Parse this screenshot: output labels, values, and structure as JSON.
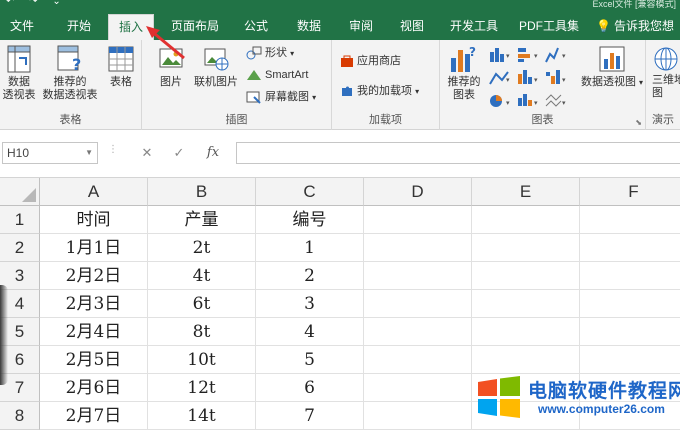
{
  "window": {
    "title": "Excel文件 [兼容模式]"
  },
  "quick_access": {
    "icon_text": "↶ ↷ ⌄"
  },
  "tabs": [
    {
      "label": "文件"
    },
    {
      "label": "开始"
    },
    {
      "label": "插入"
    },
    {
      "label": "页面布局"
    },
    {
      "label": "公式"
    },
    {
      "label": "数据"
    },
    {
      "label": "审阅"
    },
    {
      "label": "视图"
    },
    {
      "label": "开发工具"
    },
    {
      "label": "PDF工具集"
    },
    {
      "label": "告诉我您想"
    }
  ],
  "ribbon": {
    "tables": {
      "label": "表格",
      "pivot_table": "数据\n透视表",
      "recommended_pivot": "推荐的\n数据透视表",
      "table": "表格"
    },
    "illustrations": {
      "label": "插图",
      "pictures": "图片",
      "online_pictures": "联机图片",
      "shapes": "形状",
      "smartart": "SmartArt",
      "screenshot": "屏幕截图"
    },
    "addins": {
      "label": "加载项",
      "store": "应用商店",
      "my_addins": "我的加载项"
    },
    "charts": {
      "label": "图表",
      "recommended_charts": "推荐的\n图表",
      "pivot_chart": "数据透视图"
    },
    "tours": {
      "label": "演示",
      "map_3d": "三维地\n图"
    }
  },
  "formula_bar": {
    "name_box": "H10",
    "formula": ""
  },
  "grid": {
    "columns": [
      "A",
      "B",
      "C",
      "D",
      "E",
      "F"
    ],
    "rows": [
      {
        "num": "1",
        "cells": [
          "时间",
          "产量",
          "编号",
          "",
          "",
          ""
        ]
      },
      {
        "num": "2",
        "cells": [
          "1月1日",
          "2t",
          "1",
          "",
          "",
          ""
        ]
      },
      {
        "num": "3",
        "cells": [
          "2月2日",
          "4t",
          "2",
          "",
          "",
          ""
        ]
      },
      {
        "num": "4",
        "cells": [
          "2月3日",
          "6t",
          "3",
          "",
          "",
          ""
        ]
      },
      {
        "num": "5",
        "cells": [
          "2月4日",
          "8t",
          "4",
          "",
          "",
          ""
        ]
      },
      {
        "num": "6",
        "cells": [
          "2月5日",
          "10t",
          "5",
          "",
          "",
          ""
        ]
      },
      {
        "num": "7",
        "cells": [
          "2月6日",
          "12t",
          "6",
          "",
          "",
          ""
        ]
      },
      {
        "num": "8",
        "cells": [
          "2月7日",
          "14t",
          "7",
          "",
          "",
          ""
        ]
      }
    ]
  },
  "watermark": {
    "title": "电脑软硬件教程网",
    "url": "www.computer26.com"
  },
  "colors": {
    "excel_green": "#217346",
    "watermark_blue": "#1e66c8",
    "annotation_arrow": "#e03030"
  }
}
